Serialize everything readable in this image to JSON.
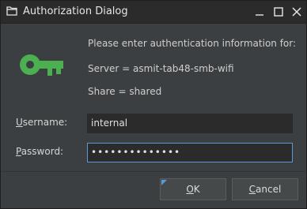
{
  "window": {
    "title": "Authorization Dialog",
    "icons": [
      "folder-icon",
      "minimize-icon",
      "maximize-icon",
      "close-icon"
    ]
  },
  "info": {
    "prompt": "Please enter authentication information for:",
    "server": "Server = asmit-tab48-smb-wifi",
    "share": "Share = shared"
  },
  "form": {
    "username_label_mnemonic": "U",
    "username_label_rest": "sername:",
    "username_value": "internal",
    "password_label_mnemonic": "P",
    "password_label_rest": "assword:",
    "password_value": "••••••••••••••"
  },
  "buttons": {
    "ok_mnemonic": "O",
    "ok_rest": "K",
    "cancel_mnemonic": "C",
    "cancel_rest": "ancel"
  },
  "colors": {
    "key_green": "#4caf50",
    "focus_blue": "#5a9bd6"
  }
}
